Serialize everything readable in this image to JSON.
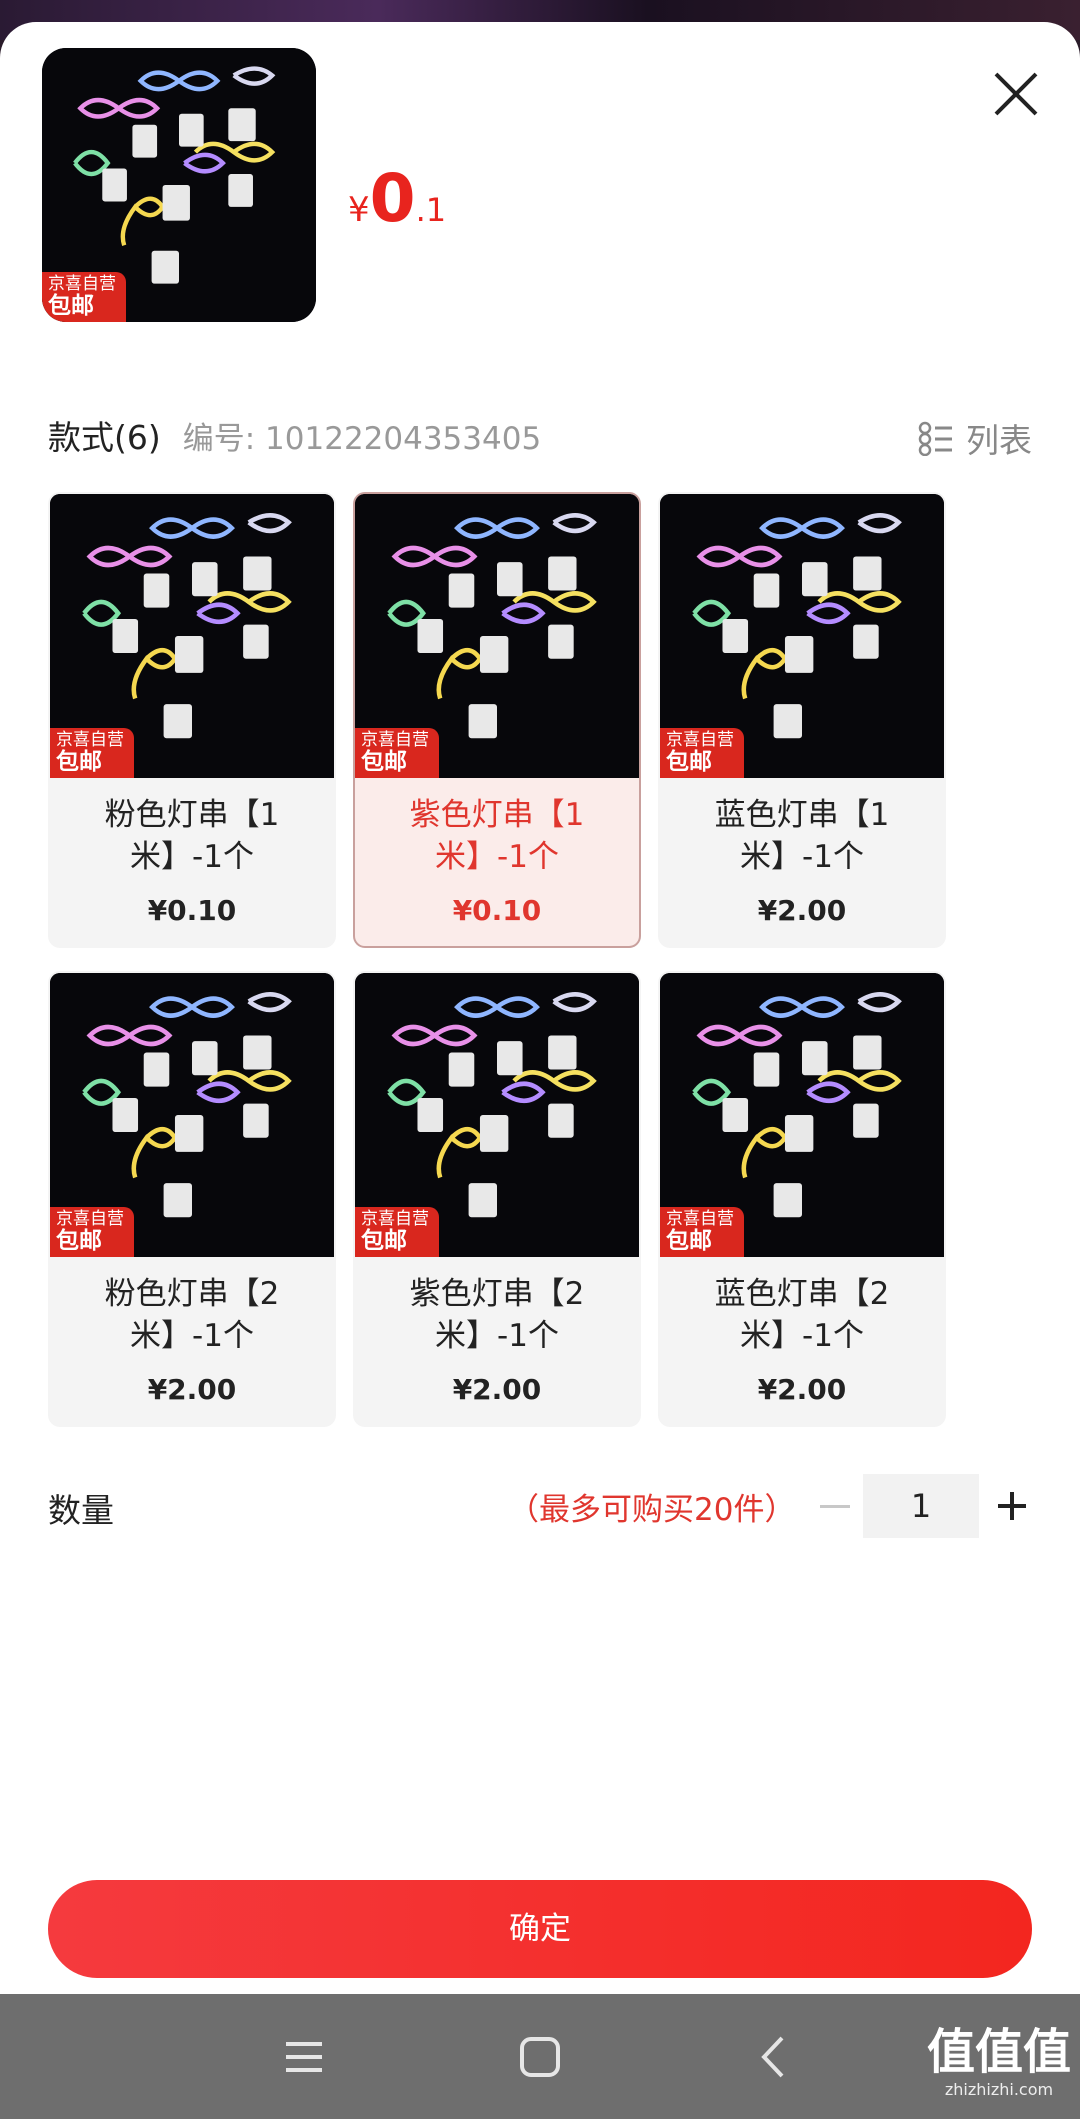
{
  "header": {
    "badge_top": "京喜自营",
    "badge_bottom": "包邮",
    "price_currency": "¥",
    "price_integer": "0",
    "price_decimal": ".1"
  },
  "spec": {
    "title": "款式(6)",
    "code_label": "编号: 10122204353405",
    "list_label": "列表"
  },
  "variants": [
    {
      "name": "粉色灯串【1米】-1个",
      "price": "¥0.10",
      "selected": false
    },
    {
      "name": "紫色灯串【1米】-1个",
      "price": "¥0.10",
      "selected": true
    },
    {
      "name": "蓝色灯串【1米】-1个",
      "price": "¥2.00",
      "selected": false
    },
    {
      "name": "粉色灯串【2米】-1个",
      "price": "¥2.00",
      "selected": false
    },
    {
      "name": "紫色灯串【2米】-1个",
      "price": "¥2.00",
      "selected": false
    },
    {
      "name": "蓝色灯串【2米】-1个",
      "price": "¥2.00",
      "selected": false
    }
  ],
  "quantity": {
    "label": "数量",
    "limit": "（最多可购买20件）",
    "value": "1"
  },
  "confirm_label": "确定",
  "watermark": {
    "title": "值值值",
    "url": "zhizhizhi.com"
  },
  "colors": {
    "accent": "#e8241e",
    "badge": "#d9271e",
    "selected_bg": "#fbecea",
    "navbar": "#6e6e6e"
  },
  "icons": [
    "close-icon",
    "list-icon",
    "minus-icon",
    "plus-icon",
    "menu-icon",
    "home-icon",
    "back-icon"
  ]
}
